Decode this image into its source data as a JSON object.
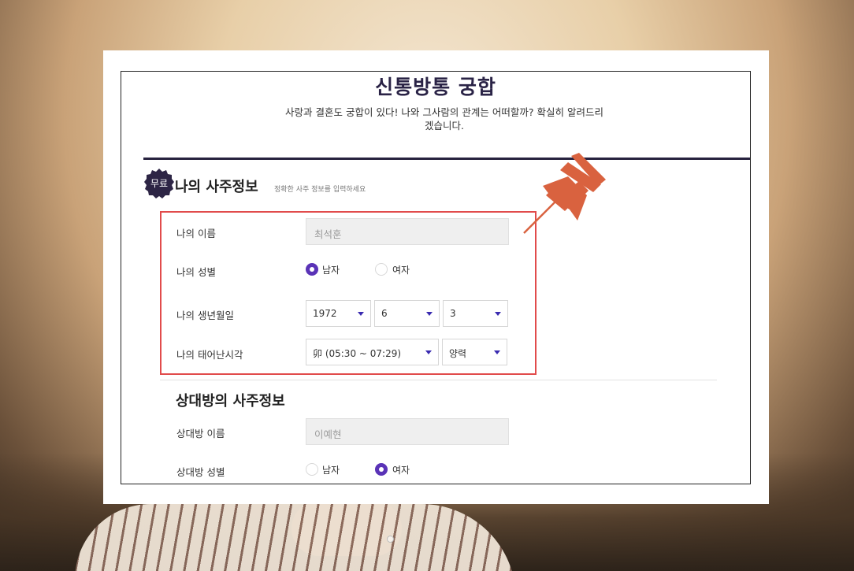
{
  "header": {
    "title": "신통방통 궁합",
    "subtitle": "사랑과 결혼도 궁합이 있다! 나와 그사람의 관계는 어떠할까? 확실히 알려드리겠습니다."
  },
  "my_section": {
    "badge": "무료",
    "title": "나의 사주정보",
    "note": "정확한 사주 정보를 입력하세요",
    "name_label": "나의 이름",
    "name_value": "최석훈",
    "gender_label": "나의 성별",
    "gender_male": "남자",
    "gender_female": "여자",
    "gender_selected": "male",
    "birth_label": "나의 생년월일",
    "birth_year": "1972",
    "birth_month": "6",
    "birth_day": "3",
    "time_label": "나의 태어난시각",
    "birth_time": "卯 (05:30 ~ 07:29)",
    "calendar": "양력"
  },
  "partner_section": {
    "title": "상대방의 사주정보",
    "name_label": "상대방 이름",
    "name_value": "이예현",
    "gender_label": "상대방 성별",
    "gender_male": "남자",
    "gender_female": "여자",
    "gender_selected": "female"
  },
  "colors": {
    "accent": "#5a33b7",
    "heading": "#2a2346",
    "highlight_border": "#e14b4b",
    "pin": "#d9623f",
    "badge": "#2d2545"
  },
  "icons": {
    "pin": "pushpin-icon",
    "badge_shape": "starburst-badge-icon",
    "dropdown": "caret-down-icon"
  }
}
